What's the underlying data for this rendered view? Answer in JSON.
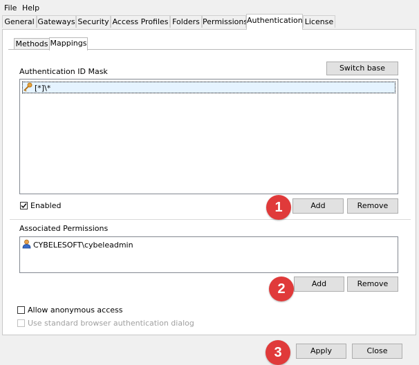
{
  "menu": {
    "file": "File",
    "help": "Help"
  },
  "tabs": [
    {
      "label": "General"
    },
    {
      "label": "Gateways"
    },
    {
      "label": "Security"
    },
    {
      "label": "Access Profiles"
    },
    {
      "label": "Folders"
    },
    {
      "label": "Permissions"
    },
    {
      "label": "Authentication"
    },
    {
      "label": "License"
    }
  ],
  "subtabs": [
    {
      "label": "Methods"
    },
    {
      "label": "Mappings"
    }
  ],
  "mask": {
    "label": "Authentication ID Mask",
    "switch_base": "Switch base",
    "items": [
      {
        "text": "[*]\\*",
        "icon": "key-icon"
      }
    ],
    "enabled_label": "Enabled",
    "enabled_checked": true,
    "add": "Add",
    "remove": "Remove"
  },
  "permissions": {
    "label": "Associated Permissions",
    "items": [
      {
        "text": "CYBELESOFT\\cybeleadmin",
        "icon": "user-icon"
      }
    ],
    "add": "Add",
    "remove": "Remove"
  },
  "options": {
    "anonymous": "Allow anonymous access",
    "anonymous_checked": false,
    "browser_dialog": "Use standard browser authentication dialog",
    "browser_dialog_checked": false
  },
  "footer": {
    "apply": "Apply",
    "close": "Close"
  },
  "badges": [
    "1",
    "2",
    "3"
  ],
  "colors": {
    "badge": "#e03a3a",
    "selection": "#e5f3ff"
  }
}
